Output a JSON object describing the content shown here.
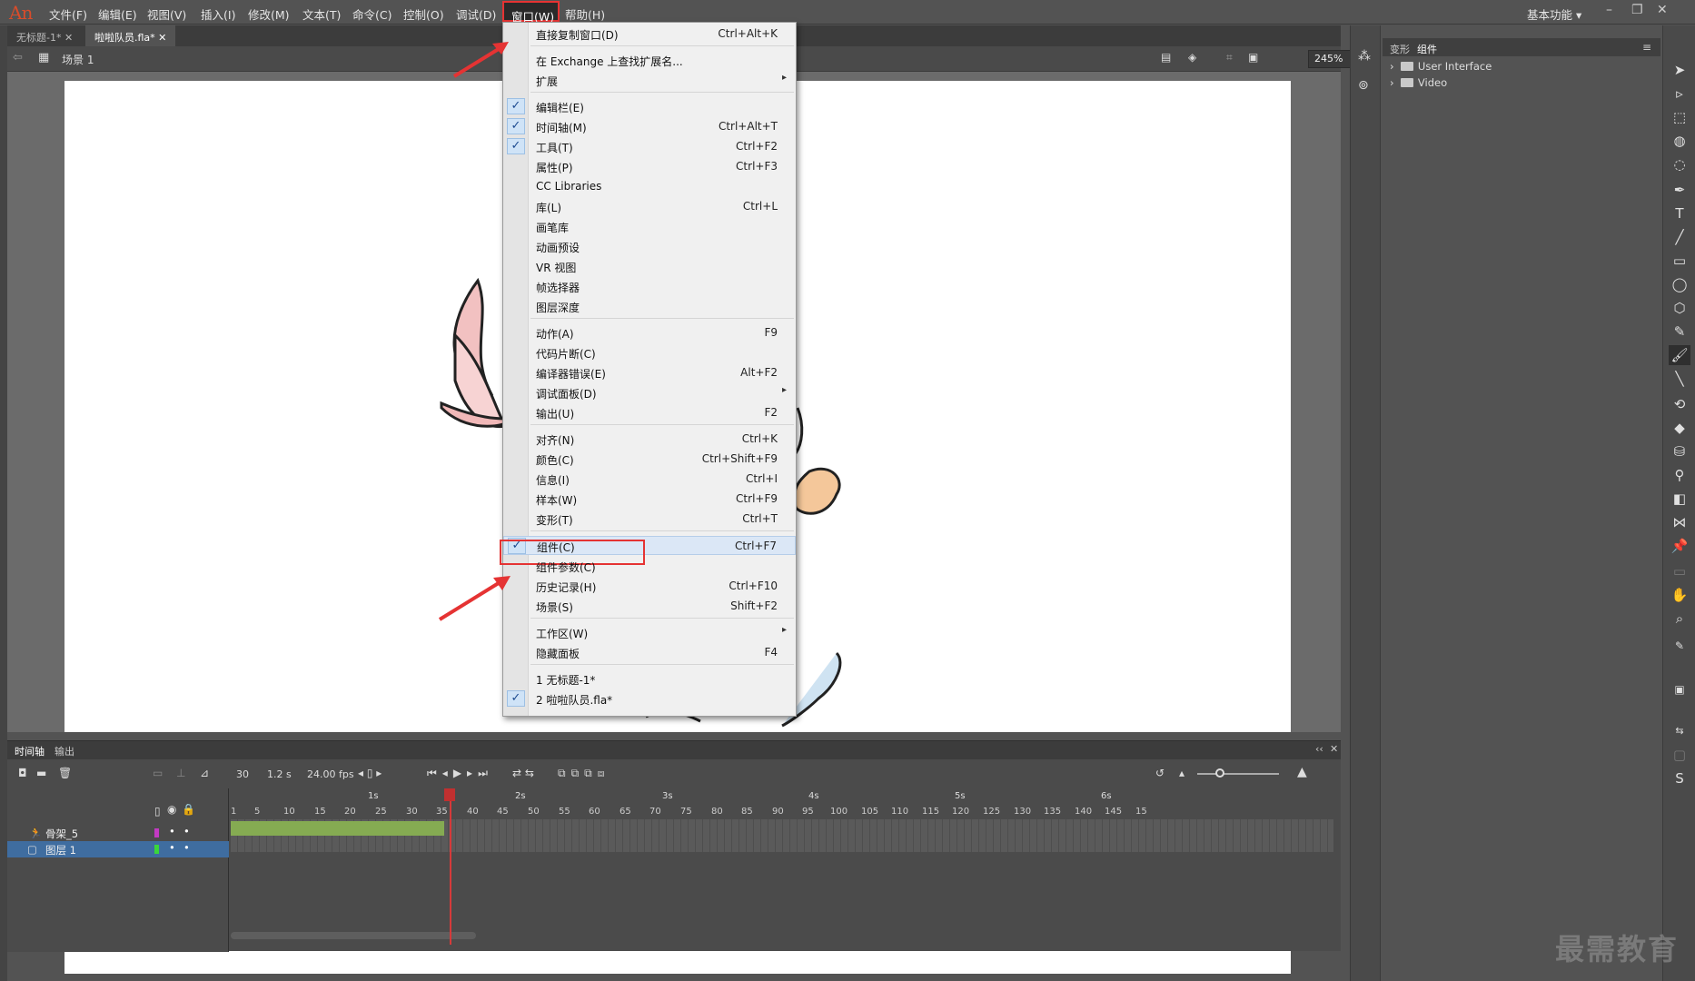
{
  "menubar": {
    "logo": "An",
    "items": [
      "文件(F)",
      "编辑(E)",
      "视图(V)",
      "插入(I)",
      "修改(M)",
      "文本(T)",
      "命令(C)",
      "控制(O)",
      "调试(D)",
      "窗口(W)",
      "帮助(H)"
    ],
    "workspace": "基本功能"
  },
  "doc_tabs": [
    "无标题-1*",
    "啦啦队员.fla*"
  ],
  "editbar": {
    "scene": "场景 1",
    "zoom": "245%"
  },
  "window_menu": {
    "items": [
      {
        "label": "直接复制窗口(D)",
        "shortcut": "Ctrl+Alt+K"
      },
      {
        "label": "在 Exchange 上查找扩展名...",
        "shortcut": ""
      },
      {
        "label": "扩展",
        "shortcut": "",
        "submenu": true
      },
      {
        "label": "编辑栏(E)",
        "shortcut": "",
        "checked": true
      },
      {
        "label": "时间轴(M)",
        "shortcut": "Ctrl+Alt+T",
        "checked": true
      },
      {
        "label": "工具(T)",
        "shortcut": "Ctrl+F2",
        "checked": true
      },
      {
        "label": "属性(P)",
        "shortcut": "Ctrl+F3"
      },
      {
        "label": "CC Libraries",
        "shortcut": ""
      },
      {
        "label": "库(L)",
        "shortcut": "Ctrl+L"
      },
      {
        "label": "画笔库",
        "shortcut": ""
      },
      {
        "label": "动画预设",
        "shortcut": ""
      },
      {
        "label": "VR 视图",
        "shortcut": ""
      },
      {
        "label": "帧选择器",
        "shortcut": ""
      },
      {
        "label": "图层深度",
        "shortcut": ""
      },
      {
        "label": "动作(A)",
        "shortcut": "F9"
      },
      {
        "label": "代码片断(C)",
        "shortcut": ""
      },
      {
        "label": "编译器错误(E)",
        "shortcut": "Alt+F2"
      },
      {
        "label": "调试面板(D)",
        "shortcut": "",
        "submenu": true
      },
      {
        "label": "输出(U)",
        "shortcut": "F2"
      },
      {
        "label": "对齐(N)",
        "shortcut": "Ctrl+K"
      },
      {
        "label": "颜色(C)",
        "shortcut": "Ctrl+Shift+F9"
      },
      {
        "label": "信息(I)",
        "shortcut": "Ctrl+I"
      },
      {
        "label": "样本(W)",
        "shortcut": "Ctrl+F9"
      },
      {
        "label": "变形(T)",
        "shortcut": "Ctrl+T"
      },
      {
        "label": "组件(C)",
        "shortcut": "Ctrl+F7",
        "checked": true,
        "highlighted": true
      },
      {
        "label": "组件参数(C)",
        "shortcut": ""
      },
      {
        "label": "历史记录(H)",
        "shortcut": "Ctrl+F10"
      },
      {
        "label": "场景(S)",
        "shortcut": "Shift+F2"
      },
      {
        "label": "工作区(W)",
        "shortcut": "",
        "submenu": true
      },
      {
        "label": "隐藏面板",
        "shortcut": "F4"
      },
      {
        "label": "1 无标题-1*",
        "shortcut": ""
      },
      {
        "label": "2 啦啦队员.fla*",
        "shortcut": "",
        "checked": true
      }
    ]
  },
  "timeline": {
    "tabs": [
      "时间轴",
      "输出"
    ],
    "current_frame": "30",
    "elapsed": "1.2 s",
    "fps": "24.00 fps",
    "layers": [
      {
        "name": "骨架_5",
        "selected": false
      },
      {
        "name": "图层 1",
        "selected": true
      }
    ],
    "seconds": [
      "1s",
      "2s",
      "3s",
      "4s",
      "5s",
      "6s"
    ],
    "frame_numbers": [
      "1",
      "5",
      "10",
      "15",
      "20",
      "25",
      "30",
      "35",
      "40",
      "45",
      "50",
      "55",
      "60",
      "65",
      "70",
      "75",
      "80",
      "85",
      "90",
      "95",
      "100",
      "105",
      "110",
      "115",
      "120",
      "125",
      "130",
      "135",
      "140",
      "145",
      "15"
    ]
  },
  "components_panel": {
    "tabs": [
      "变形",
      "组件"
    ],
    "folders": [
      "User Interface",
      "Video"
    ]
  },
  "watermark": "最需教育",
  "accent_colors": {
    "highlight_box": "#e53333",
    "tween": "#85ab52",
    "selected_layer": "#3f6da0",
    "playhead": "#d63a3a",
    "check_bg": "#cfe3f7"
  }
}
